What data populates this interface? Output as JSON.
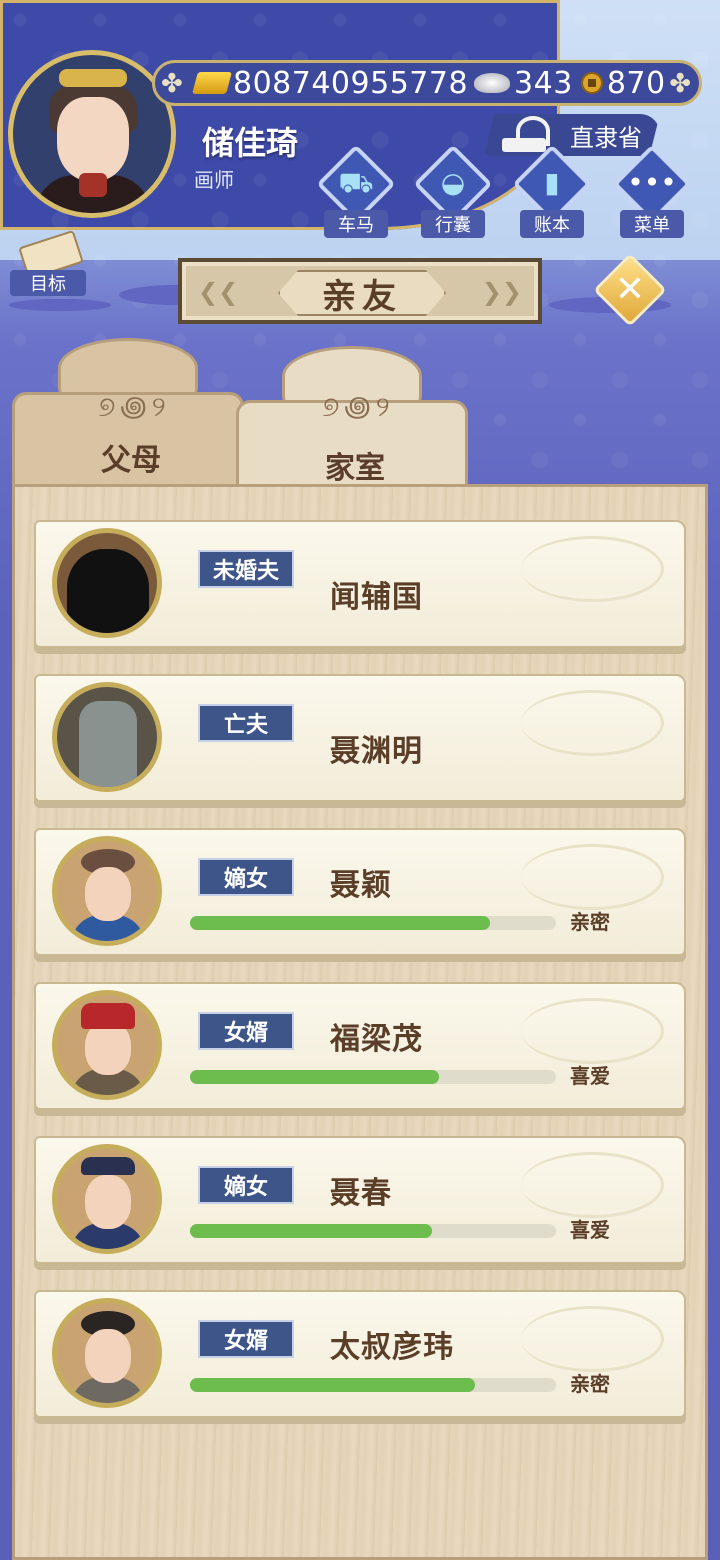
{
  "player": {
    "name": "储佳琦",
    "title": "画师",
    "province": "直隶省"
  },
  "currency": {
    "gold": "808740955778",
    "silver": "343",
    "coins": "870"
  },
  "top_menu": [
    {
      "label": "车马",
      "icon": "carriage-icon"
    },
    {
      "label": "行囊",
      "icon": "bag-icon"
    },
    {
      "label": "账本",
      "icon": "ledger-icon"
    },
    {
      "label": "菜单",
      "icon": "more-icon"
    }
  ],
  "goal_label": "目标",
  "page_title": "亲友",
  "tabs": [
    {
      "label": "父母",
      "active": false
    },
    {
      "label": "家室",
      "active": true
    }
  ],
  "members": [
    {
      "relation": "未婚夫",
      "name": "闻辅国",
      "affinity_label": "",
      "affinity": null,
      "avatar": "silhouette"
    },
    {
      "relation": "亡夫",
      "name": "聂渊明",
      "affinity_label": "",
      "affinity": null,
      "avatar": "tombstone"
    },
    {
      "relation": "嫡女",
      "name": "聂颖",
      "affinity_label": "亲密",
      "affinity": 0.82,
      "avatar": "girl"
    },
    {
      "relation": "女婿",
      "name": "福梁茂",
      "affinity_label": "喜爱",
      "affinity": 0.68,
      "avatar": "official-red-hat"
    },
    {
      "relation": "嫡女",
      "name": "聂春",
      "affinity_label": "喜爱",
      "affinity": 0.66,
      "avatar": "boy-crown"
    },
    {
      "relation": "女婿",
      "name": "太叔彦玮",
      "affinity_label": "亲密",
      "affinity": 0.78,
      "avatar": "scholar"
    }
  ],
  "colors": {
    "bar_fill": "#6cbc4e",
    "tag_bg": "#3d5588"
  }
}
